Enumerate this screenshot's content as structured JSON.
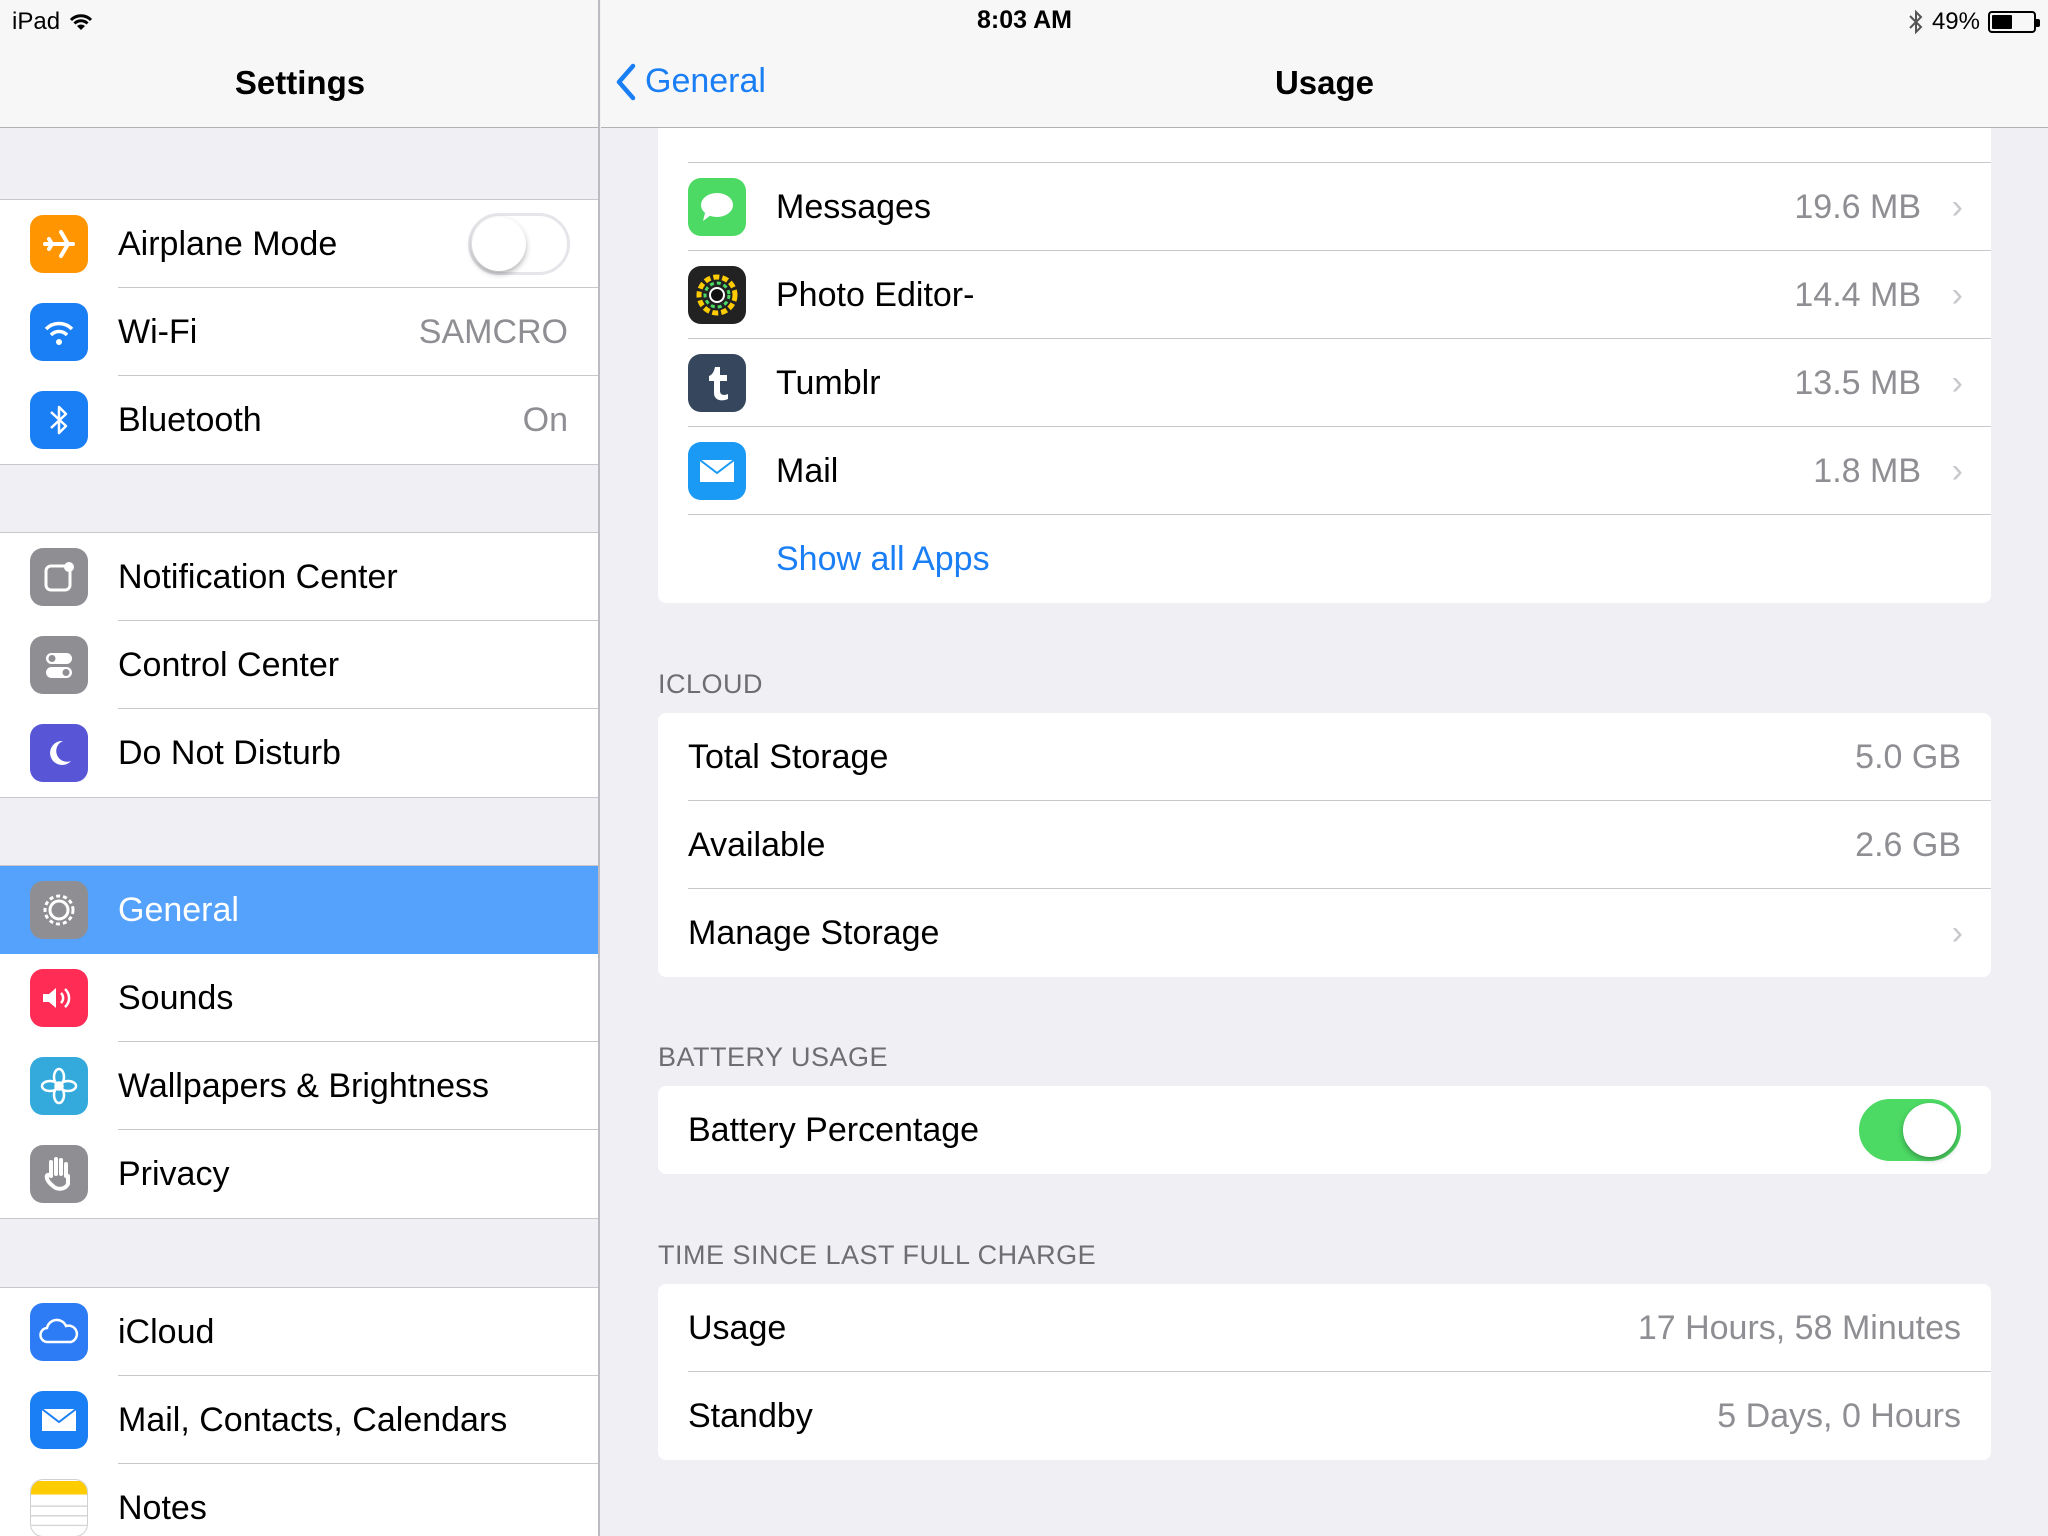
{
  "status": {
    "device": "iPad",
    "time": "8:03 AM",
    "battery": "49%"
  },
  "sidebar": {
    "title": "Settings",
    "airplane": {
      "label": "Airplane Mode",
      "on": false
    },
    "wifi": {
      "label": "Wi-Fi",
      "value": "SAMCRO"
    },
    "bluetooth": {
      "label": "Bluetooth",
      "value": "On"
    },
    "notification": {
      "label": "Notification Center"
    },
    "control": {
      "label": "Control Center"
    },
    "dnd": {
      "label": "Do Not Disturb"
    },
    "general": {
      "label": "General"
    },
    "sounds": {
      "label": "Sounds"
    },
    "wallpapers": {
      "label": "Wallpapers & Brightness"
    },
    "privacy": {
      "label": "Privacy"
    },
    "icloud": {
      "label": "iCloud"
    },
    "mail": {
      "label": "Mail, Contacts, Calendars"
    },
    "notes": {
      "label": "Notes"
    }
  },
  "detail": {
    "back": "General",
    "title": "Usage",
    "apps": [
      {
        "name": "Messages",
        "size": "19.6 MB",
        "icon": "messages-icon"
      },
      {
        "name": "Photo Editor-",
        "size": "14.4 MB",
        "icon": "photo-editor-icon"
      },
      {
        "name": "Tumblr",
        "size": "13.5 MB",
        "icon": "tumblr-icon"
      },
      {
        "name": "Mail",
        "size": "1.8 MB",
        "icon": "mail-icon"
      }
    ],
    "show_all": "Show all Apps",
    "icloud": {
      "header": "ICLOUD",
      "total": {
        "label": "Total Storage",
        "value": "5.0 GB"
      },
      "available": {
        "label": "Available",
        "value": "2.6 GB"
      },
      "manage": {
        "label": "Manage Storage"
      }
    },
    "battery": {
      "header": "BATTERY USAGE",
      "percentage": {
        "label": "Battery Percentage",
        "on": true
      }
    },
    "charge": {
      "header": "TIME SINCE LAST FULL CHARGE",
      "usage": {
        "label": "Usage",
        "value": "17 Hours, 58 Minutes"
      },
      "standby": {
        "label": "Standby",
        "value": "5 Days, 0 Hours"
      }
    }
  },
  "colors": {
    "accent": "#1a7ef5",
    "selected": "#55a2fc",
    "toggle_on": "#4cd964",
    "airplane": "#ff9500",
    "wifi": "#1a7ef5",
    "bluetooth": "#1a7ef5",
    "notification": "#8e8e93",
    "control": "#8e8e93",
    "dnd": "#5856d6",
    "sounds": "#ff2d55",
    "wallpapers": "#34aadc",
    "privacy": "#8e8e93",
    "icloud": "#2d7cf5",
    "mail": "#1a7ef5",
    "notes": "#ffcc00"
  }
}
